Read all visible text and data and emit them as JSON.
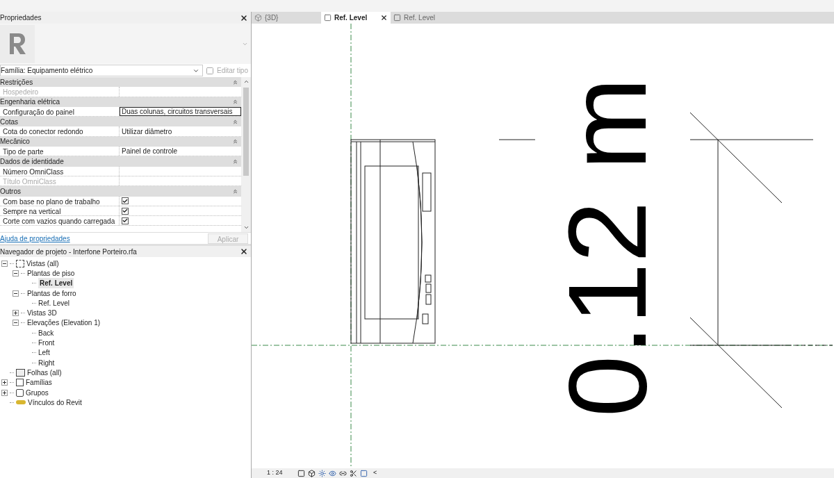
{
  "properties": {
    "title": "Propriedades",
    "family": "Família: Equipamento elétrico",
    "edit_type": "Editar tipo",
    "groups": [
      {
        "name": "Restrições",
        "expanded": true,
        "rows": [
          {
            "label": "Hospedeiro",
            "kind": "text",
            "value": "",
            "disabled": true
          }
        ]
      },
      {
        "name": "Engenharia elétrica",
        "expanded": true,
        "rows": [
          {
            "label": "Configuração do painel",
            "kind": "text",
            "value": "Duas colunas, circuitos transversais",
            "disabled": false,
            "editing": true
          }
        ]
      },
      {
        "name": "Cotas",
        "expanded": true,
        "rows": [
          {
            "label": "Cota do conector redondo",
            "kind": "text",
            "value": "Utilizar diâmetro",
            "disabled": false,
            "editing": false
          }
        ]
      },
      {
        "name": "Mecânico",
        "expanded": true,
        "rows": [
          {
            "label": "Tipo de parte",
            "kind": "text",
            "value": "Painel de controle",
            "disabled": false,
            "editing": false
          }
        ]
      },
      {
        "name": "Dados de identidade",
        "expanded": true,
        "rows": [
          {
            "label": "Número OmniClass",
            "kind": "text",
            "value": "",
            "disabled": false
          },
          {
            "label": "Título OmniClass",
            "kind": "text",
            "value": "",
            "disabled": true
          }
        ]
      },
      {
        "name": "Outros",
        "expanded": true,
        "rows": [
          {
            "label": "Com base no plano de trabalho",
            "kind": "checkbox",
            "checked": true,
            "disabled": false
          },
          {
            "label": "Sempre na vertical",
            "kind": "checkbox",
            "checked": true,
            "disabled": false
          },
          {
            "label": "Corte com vazios quando carregada",
            "kind": "checkbox",
            "checked": true,
            "disabled": false
          }
        ]
      }
    ],
    "help_link": "Ajuda de propriedades",
    "apply_button": {
      "label": "Aplicar",
      "disabled": true
    }
  },
  "browser": {
    "title": "Navegador de projeto - Interfone Porteiro.rfa",
    "tree": [
      {
        "label": "Vistas (all)",
        "kind": "views",
        "expanded": true,
        "active": false,
        "children": [
          {
            "label": "Plantas de piso",
            "expanded": true,
            "active": false,
            "children": [
              {
                "label": "Ref. Level",
                "active": true
              }
            ]
          },
          {
            "label": "Plantas de forro",
            "expanded": true,
            "active": false,
            "children": [
              {
                "label": "Ref. Level",
                "active": false
              }
            ]
          },
          {
            "label": "Vistas 3D",
            "expanded": false,
            "active": false
          },
          {
            "label": "Elevações (Elevation 1)",
            "expanded": true,
            "active": false,
            "children": [
              {
                "label": "Back",
                "active": false
              },
              {
                "label": "Front",
                "active": false
              },
              {
                "label": "Left",
                "active": false
              },
              {
                "label": "Right",
                "active": false
              }
            ]
          }
        ]
      },
      {
        "label": "Folhas (all)",
        "kind": "sheets",
        "active": false
      },
      {
        "label": "Famílias",
        "kind": "families",
        "expanded": false,
        "active": false
      },
      {
        "label": "Grupos",
        "kind": "groups",
        "expanded": false,
        "active": false
      },
      {
        "label": "Vínculos do Revit",
        "kind": "links",
        "active": false
      }
    ]
  },
  "tabs": [
    {
      "label": "{3D}",
      "kind": "model",
      "selected": false
    },
    {
      "label": "Ref. Level",
      "kind": "plan",
      "selected": true
    },
    {
      "label": "Ref. Level",
      "kind": "plan",
      "selected": false
    }
  ],
  "canvas": {
    "dimension_text": "0.12 m"
  },
  "status_bar": {
    "scale": "1 : 24",
    "collapse": "<"
  }
}
